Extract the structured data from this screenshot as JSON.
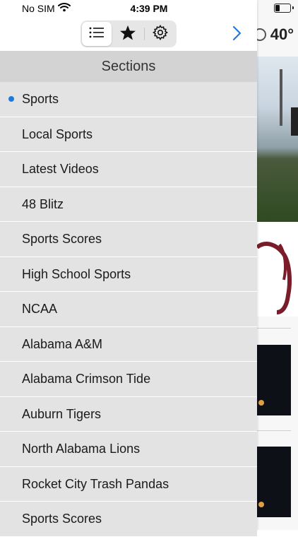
{
  "status_bar": {
    "carrier": "No SIM",
    "time": "4:39 PM"
  },
  "background": {
    "temperature": "40°"
  },
  "toolbar": {
    "tabs": [
      {
        "name": "sections",
        "icon": "list-icon",
        "active": true
      },
      {
        "name": "favorites",
        "icon": "star-icon",
        "active": false
      },
      {
        "name": "settings",
        "icon": "gear-icon",
        "active": false
      }
    ],
    "forward_icon": "chevron-right-icon"
  },
  "sections": {
    "title": "Sections",
    "items": [
      {
        "label": "Sports",
        "selected": true
      },
      {
        "label": "Local Sports"
      },
      {
        "label": "Latest Videos"
      },
      {
        "label": "48 Blitz"
      },
      {
        "label": "Sports Scores"
      },
      {
        "label": "High School Sports"
      },
      {
        "label": "NCAA"
      },
      {
        "label": "Alabama A&M"
      },
      {
        "label": "Alabama Crimson Tide"
      },
      {
        "label": "Auburn Tigers"
      },
      {
        "label": "North Alabama Lions"
      },
      {
        "label": "Rocket City Trash Pandas"
      },
      {
        "label": "Sports Scores"
      }
    ]
  },
  "colors": {
    "accent": "#1f7ae0",
    "drawer_bg": "#e3e3e3",
    "header_bg": "#d3d3d3"
  }
}
